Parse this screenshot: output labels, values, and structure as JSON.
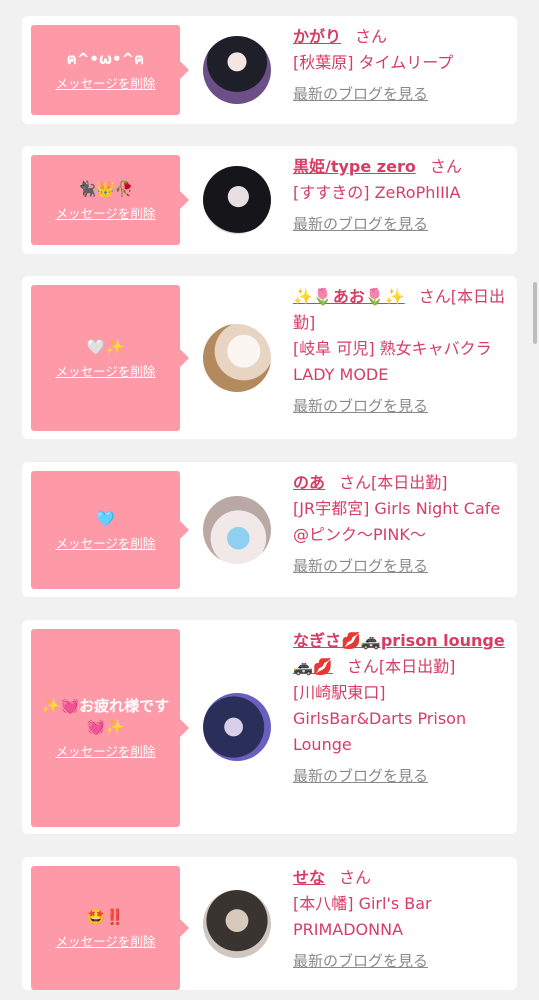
{
  "cards": [
    {
      "message": "ฅ^•ω•^ฅ",
      "delete_label": "メッセージを削除",
      "name": "かがり",
      "suffix": "さん",
      "shop": "[秋葉原] タイムリープ",
      "blog_label": "最新のブログを見る",
      "avatar_colors": [
        "#1f1f2a",
        "#6b4f86"
      ]
    },
    {
      "message": "🐈‍⬛👑🥀",
      "delete_label": "メッセージを削除",
      "name": "黒姫/type zero",
      "suffix": "さん",
      "shop": "[すすきの] ZeRoPhIIIA",
      "blog_label": "最新のブログを見る",
      "avatar_colors": [
        "#15151a",
        "#d9d4da"
      ]
    },
    {
      "message": "🤍✨",
      "delete_label": "メッセージを削除",
      "name": "✨🌷あお🌷✨",
      "suffix": "さん[本日出勤]",
      "shop": "[岐阜 可児] 熟女キャバクラ LADY MODE",
      "blog_label": "最新のブログを見る",
      "avatar_colors": [
        "#f5efe8",
        "#b38a5e"
      ]
    },
    {
      "message": "🩵",
      "delete_label": "メッセージを削除",
      "name": "のあ",
      "suffix": "さん[本日出勤]",
      "shop": "[JR宇都宮] Girls Night Cafe @ピンク〜PINK〜",
      "blog_label": "最新のブログを見る",
      "avatar_colors": [
        "#f1e9e7",
        "#8fd0f0"
      ]
    },
    {
      "message": "✨💓お疲れ様です💓✨",
      "delete_label": "メッセージを削除",
      "name": "なぎさ💋🚓prison lounge🚓💋",
      "suffix": "さん[本日出勤]",
      "shop": "[川崎駅東口] GirlsBar&Darts Prison Lounge",
      "blog_label": "最新のブログを見る",
      "avatar_colors": [
        "#2a2f5a",
        "#6a5fbf"
      ]
    },
    {
      "message": "🤩‼️",
      "delete_label": "メッセージを削除",
      "name": "せな",
      "suffix": "さん",
      "shop": "[本八幡] Girl's Bar PRIMADONNA",
      "blog_label": "最新のブログを見る",
      "avatar_colors": [
        "#3a3430",
        "#cfc6bf"
      ]
    }
  ]
}
